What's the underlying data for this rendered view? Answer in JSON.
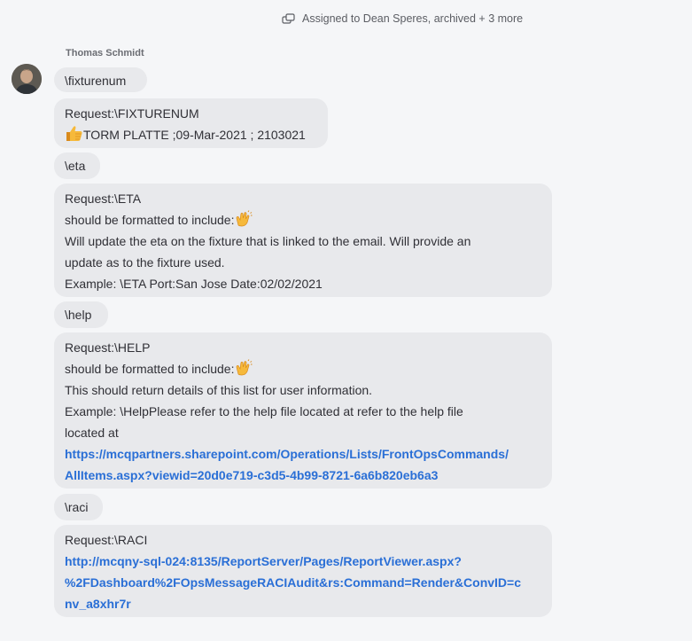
{
  "header": {
    "assignment_text": "Assigned to Dean Speres, archived + 3 more"
  },
  "message": {
    "author": "Thomas Schmidt"
  },
  "bubbles": {
    "b1": {
      "text": "\\fixturenum"
    },
    "b2": {
      "line1": "Request:\\FIXTURENUM",
      "line2": "TORM PLATTE ;09-Mar-2021 ; 2103021"
    },
    "b3": {
      "text": "\\eta"
    },
    "b4": {
      "line1": "Request:\\ETA",
      "line2": "should be formatted to include:",
      "line3": "Will update the eta on the fixture that is linked to the email. Will provide an",
      "line4": "update as to the fixture used.",
      "line5": "Example: \\ETA Port:San Jose Date:02/02/2021"
    },
    "b5": {
      "text": "\\help"
    },
    "b6": {
      "line1": "Request:\\HELP",
      "line2": "should be formatted to include:",
      "line3": "This should return details of this list for user information.",
      "line4": "Example: \\HelpPlease refer to the help file located at refer to the help file",
      "line5": "located at",
      "link_line1": "https://mcqpartners.sharepoint.com/Operations/Lists/FrontOpsCommands/",
      "link_line2": "AllItems.aspx?viewid=20d0e719-c3d5-4b99-8721-6a6b820eb6a3"
    },
    "b7": {
      "text": "\\raci"
    },
    "b8": {
      "line1": "Request:\\RACI",
      "link_line1": "http://mcqny-sql-024:8135/ReportServer/Pages/ReportViewer.aspx?",
      "link_line2": "%2FDashboard%2FOpsMessageRACIAudit&rs:Command=Render&ConvID=c",
      "link_line3": "nv_a8xhr7r"
    }
  },
  "icons": {
    "assign": "assign-icon",
    "thumbs": "thumbs-up-emoji",
    "clap": "clapping-hands-emoji"
  },
  "colors": {
    "background": "#f5f6f8",
    "bubble": "#e8e9ec",
    "link": "#2a6fd6"
  }
}
